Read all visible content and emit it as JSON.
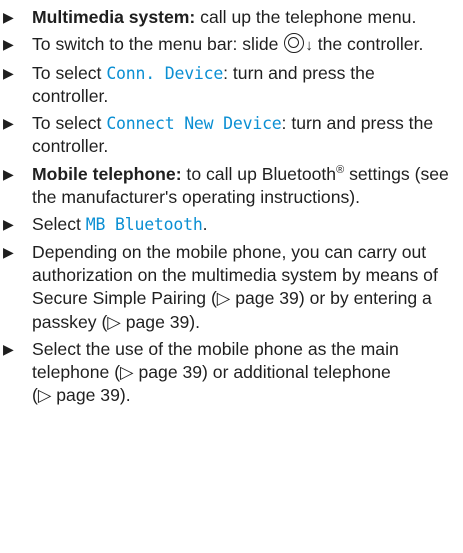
{
  "steps": [
    {
      "bold": "Multimedia system:",
      "text": " call up the telephone menu."
    },
    {
      "pre": "To switch to the menu bar: slide",
      "arrow": "↓",
      "post": " the controller."
    },
    {
      "pre": "To select ",
      "ui": "Conn. Device",
      "post": ": turn and press the controller."
    },
    {
      "pre": "To select ",
      "ui": "Connect New Device",
      "post": ": turn and press the controller."
    },
    {
      "bold": "Mobile telephone:",
      "pre": " to call up Bluetooth",
      "sup": "®",
      "post": " settings (see the manufacturer's operating instructions)."
    },
    {
      "pre": "Select ",
      "ui": "MB Bluetooth",
      "post": "."
    },
    {
      "pre": "Depending on the mobile phone, you can carry out authorization on the multimedia system by means of Secure Simple Pairing ",
      "ref1": "(▷ page 39)",
      "mid": " or by entering a passkey ",
      "ref2": "(▷ page 39)",
      "post": "."
    },
    {
      "pre": "Select the use of the mobile phone as the main telephone ",
      "ref1": "(▷ page 39)",
      "mid": " or additional telephone ",
      "ref2": "(▷ page 39)",
      "post": "."
    }
  ],
  "bullet_symbol": "▶",
  "icons": {
    "controller": "controller-icon"
  },
  "colors": {
    "ui_text": "#0b8fd3",
    "body_text": "#1f1f1f"
  }
}
